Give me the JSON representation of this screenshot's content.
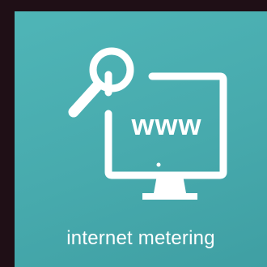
{
  "tile": {
    "label": "internet metering",
    "screen_text": "www",
    "icons": [
      "magnifier-icon",
      "monitor-icon",
      "www-text"
    ],
    "colors": {
      "tile_background": "#4aafb1",
      "page_background": "#1f0f16",
      "foreground": "#ffffff"
    }
  }
}
